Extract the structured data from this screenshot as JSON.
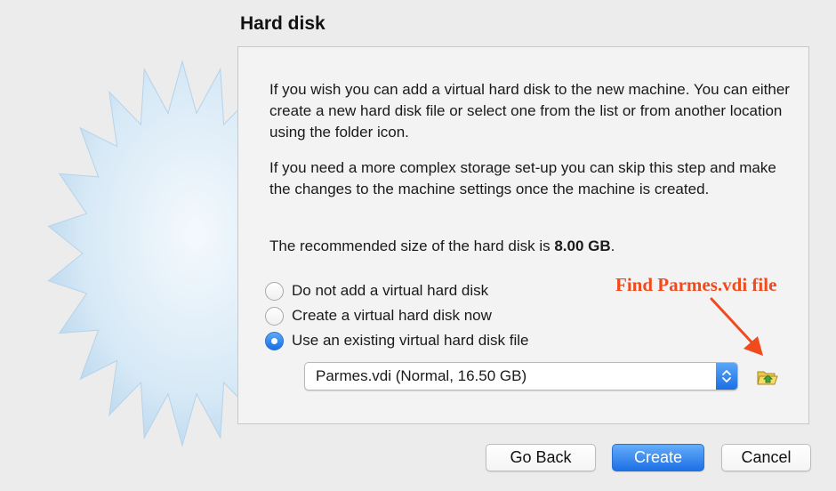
{
  "page": {
    "title": "Hard disk"
  },
  "info": {
    "para1": "If you wish you can add a virtual hard disk to the new machine. You can either create a new hard disk file or select one from the list or from another location using the folder icon.",
    "para2": "If you need a more complex storage set-up you can skip this step and make the changes to the machine settings once the machine is created.",
    "recommended_prefix": "The recommended size of the hard disk is ",
    "recommended_size": "8.00 GB",
    "recommended_suffix": "."
  },
  "options": [
    {
      "label": "Do not add a virtual hard disk",
      "checked": false
    },
    {
      "label": "Create a virtual hard disk now",
      "checked": false
    },
    {
      "label": "Use an existing virtual hard disk file",
      "checked": true
    }
  ],
  "disk_select": {
    "value": "Parmes.vdi (Normal, 16.50 GB)",
    "icon": "chevron-updown-icon"
  },
  "folder_button": {
    "icon": "folder-open-icon"
  },
  "annotation": {
    "text": "Find Parmes.vdi file",
    "color": "#f04a1f"
  },
  "buttons": {
    "back": "Go Back",
    "create": "Create",
    "cancel": "Cancel"
  },
  "colors": {
    "accent": "#1d6fe5",
    "background": "#ececec"
  }
}
